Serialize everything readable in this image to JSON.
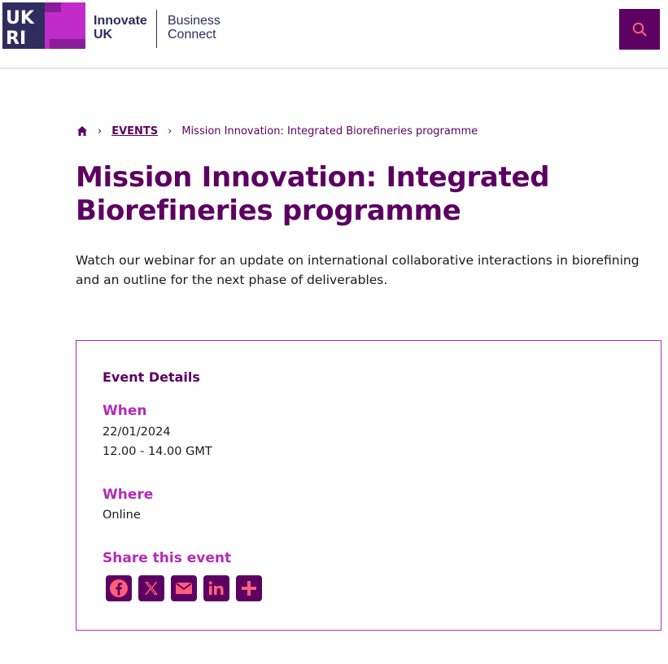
{
  "header": {
    "logo_text": "UKRI",
    "brand_line1": "Innovate",
    "brand_line2": "UK",
    "partner_line1": "Business",
    "partner_line2": "Connect",
    "search_icon": "search-icon"
  },
  "breadcrumb": {
    "home_icon": "home-icon",
    "events_label": "EVENTS",
    "current_label": "Mission Innovation: Integrated Biorefineries programme"
  },
  "page": {
    "title": "Mission Innovation: Integrated Biorefineries programme",
    "intro": "Watch our webinar for an update on international collaborative interactions in biorefining and an outline for the next phase of deliverables."
  },
  "event_details": {
    "heading": "Event Details",
    "when_label": "When",
    "date": "22/01/2024",
    "time": "12.00 - 14.00 GMT",
    "where_label": "Where",
    "location": "Online",
    "share_label": "Share this event",
    "share_icons": [
      "facebook-icon",
      "x-icon",
      "email-icon",
      "linkedin-icon",
      "plus-icon"
    ]
  },
  "colors": {
    "brand_purple": "#5c0062",
    "accent_magenta": "#b32bb9",
    "icon_accent": "#ff5f7b",
    "brand_navy": "#2e2d5e"
  }
}
